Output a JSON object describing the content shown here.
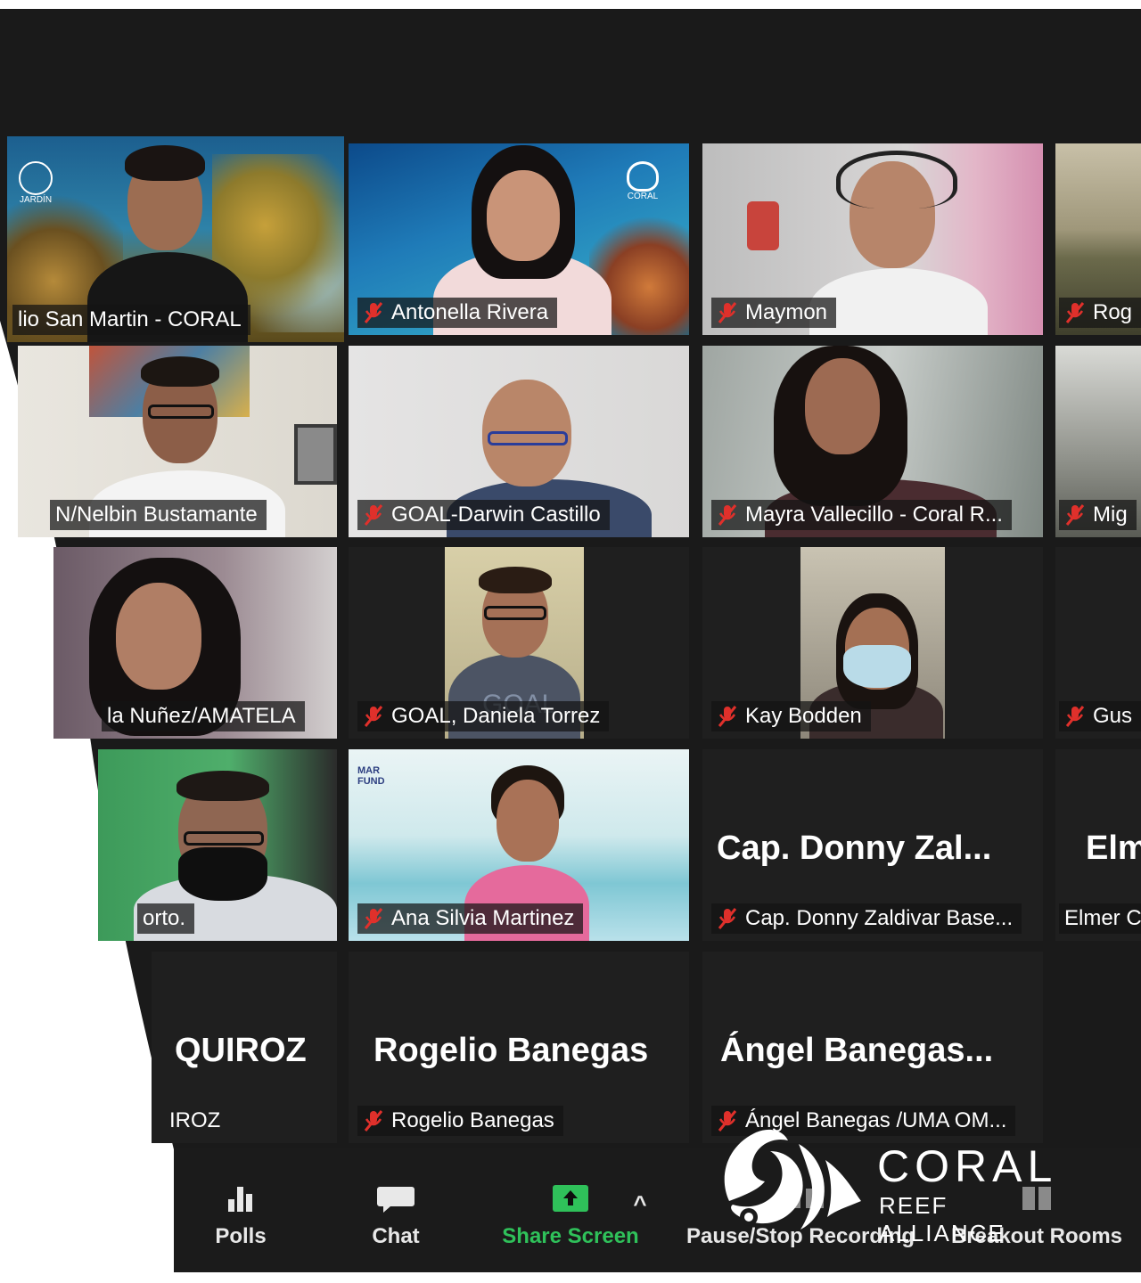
{
  "participants": [
    {
      "label": "lio San Martin - CORAL",
      "muted": false
    },
    {
      "label": "Antonella Rivera",
      "muted": true
    },
    {
      "label": "Maymon",
      "muted": true
    },
    {
      "label": "Rog",
      "muted": true
    },
    {
      "label": "N/Nelbin Bustamante",
      "muted": false
    },
    {
      "label": "GOAL-Darwin Castillo",
      "muted": true
    },
    {
      "label": "Mayra Vallecillo - Coral R...",
      "muted": true
    },
    {
      "label": "Mig",
      "muted": true
    },
    {
      "label": "la Nuñez/AMATELA",
      "muted": false
    },
    {
      "label": "GOAL, Daniela Torrez",
      "muted": true
    },
    {
      "label": "Kay Bodden",
      "muted": true
    },
    {
      "label": "Gus",
      "muted": true
    },
    {
      "label": "orto.",
      "muted": false
    },
    {
      "label": "Ana Silvia Martinez",
      "muted": true
    },
    {
      "label": "Cap. Donny Zaldivar Base...",
      "display": "Cap.  Donny  Zal...",
      "muted": true
    },
    {
      "label": "Elmer C",
      "display": "Elm",
      "muted": false
    },
    {
      "label": "IROZ",
      "display": "QUIROZ",
      "muted": false
    },
    {
      "label": "Rogelio Banegas",
      "display": "Rogelio  Banegas",
      "muted": true
    },
    {
      "label": "Ángel Banegas /UMA OM...",
      "display": "Ángel  Banegas...",
      "muted": true
    }
  ],
  "tile_text": {
    "coral_logo_small": "CORAL",
    "mar_fund_logo": "MAR FUND",
    "jardin_logo": "JARDÍN",
    "shirt_text": "GOAL"
  },
  "toolbar": {
    "polls": "Polls",
    "chat": "Chat",
    "share_screen": "Share Screen",
    "caret": "^",
    "recording": "Pause/Stop Recording",
    "breakout": "Breakout Rooms"
  },
  "logo": {
    "word": "CORAL",
    "sub": "REEF ALLIANCE"
  },
  "colors": {
    "meeting_bg": "#1a1a1a",
    "active_speaker_border": "#e5e23c",
    "share_green": "#2fc15a",
    "muted_red": "#e0302b"
  },
  "icons": {
    "muted": "microphone-muted-icon",
    "polls": "bar-chart-icon",
    "chat": "speech-bubble-icon",
    "share": "share-screen-arrow-icon",
    "recording": "pause-stop-icon",
    "breakout": "breakout-rooms-icon"
  }
}
